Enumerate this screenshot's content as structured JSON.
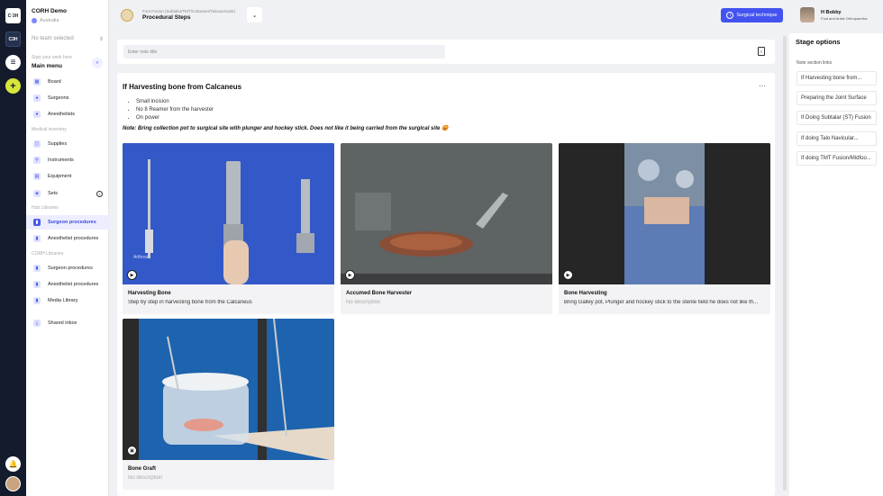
{
  "rail": {
    "logo_top": "C·3H",
    "logo_second": "C3H",
    "menu_icon": "hamburger-icon",
    "add_icon": "plus-icon",
    "bell_icon": "bell-icon"
  },
  "sidebar": {
    "org_name": "CORH Demo",
    "org_region": "Australia",
    "team_select": "No team selected",
    "search_hint": "Start your work here",
    "menu_title": "Main menu",
    "main_items": [
      {
        "label": "Board",
        "icon": "board-icon"
      },
      {
        "label": "Surgeons",
        "icon": "surgeon-icon"
      },
      {
        "label": "Anesthetists",
        "icon": "anesthetist-icon"
      }
    ],
    "medical_inventory_label": "Medical inventory",
    "inventory_items": [
      {
        "label": "Supplies",
        "icon": "supplies-icon"
      },
      {
        "label": "Instruments",
        "icon": "instruments-icon"
      },
      {
        "label": "Equipment",
        "icon": "equipment-icon"
      },
      {
        "label": "Sets",
        "icon": "sets-icon"
      }
    ],
    "hub_libraries_label": "Hub Libraries",
    "hub_items": [
      {
        "label": "Surgeon procedures",
        "active": true
      },
      {
        "label": "Anesthetist procedures",
        "active": false
      }
    ],
    "corh_libraries_label": "CORH Libraries",
    "corh_items": [
      {
        "label": "Surgeon procedures"
      },
      {
        "label": "Anesthetist procedures"
      },
      {
        "label": "Media Library"
      }
    ],
    "shared_inbox": "Shared inbox"
  },
  "header": {
    "breadcrumb_parent": "Foot Fusion (Subtalar/TMT/Calcaneo/Talonavicular)",
    "breadcrumb_current": "Procedural Steps",
    "surgical_technique_label": "Surgical technique",
    "user_name": "H Bobby",
    "user_role": "Foot and Ankle Orthopaedics"
  },
  "note": {
    "placeholder": "Enter note title"
  },
  "section": {
    "title": "If Harvesting bone from Calcaneus",
    "bullets": [
      "Small incision",
      "No 8 Reamer from the harvester",
      "On power"
    ],
    "note_text": "Note: Bring collection pot to surgical site with plunger and hockey stick. Does not like it being carried from the surgical site 😡",
    "videos": [
      {
        "title": "Harvesting Bone",
        "description": "Step by step in harvesting bone from the Calcaneus",
        "watermark": "Arthrex"
      },
      {
        "title": "Accumed Bone Harvester",
        "description": "No description"
      },
      {
        "title": "Bone Harvesting",
        "description": "Bring Galley pot, Plunger and hockey stick to the sterile field he does not like th..."
      },
      {
        "title": "Bone Graft",
        "description": "No description"
      }
    ]
  },
  "stage_options": {
    "title": "Stage options",
    "label": "Note section links",
    "links": [
      "If Harvesting bone from...",
      "Preparing the Joint Surface",
      "If Doing Subtalar (ST) Fusion",
      "If doing Talo Navicular...",
      "If doing TMT Fusion/Midfoo..."
    ]
  },
  "colors": {
    "rail": "#141b2d",
    "accent": "#4353f0",
    "add_button": "#d6e63a"
  }
}
